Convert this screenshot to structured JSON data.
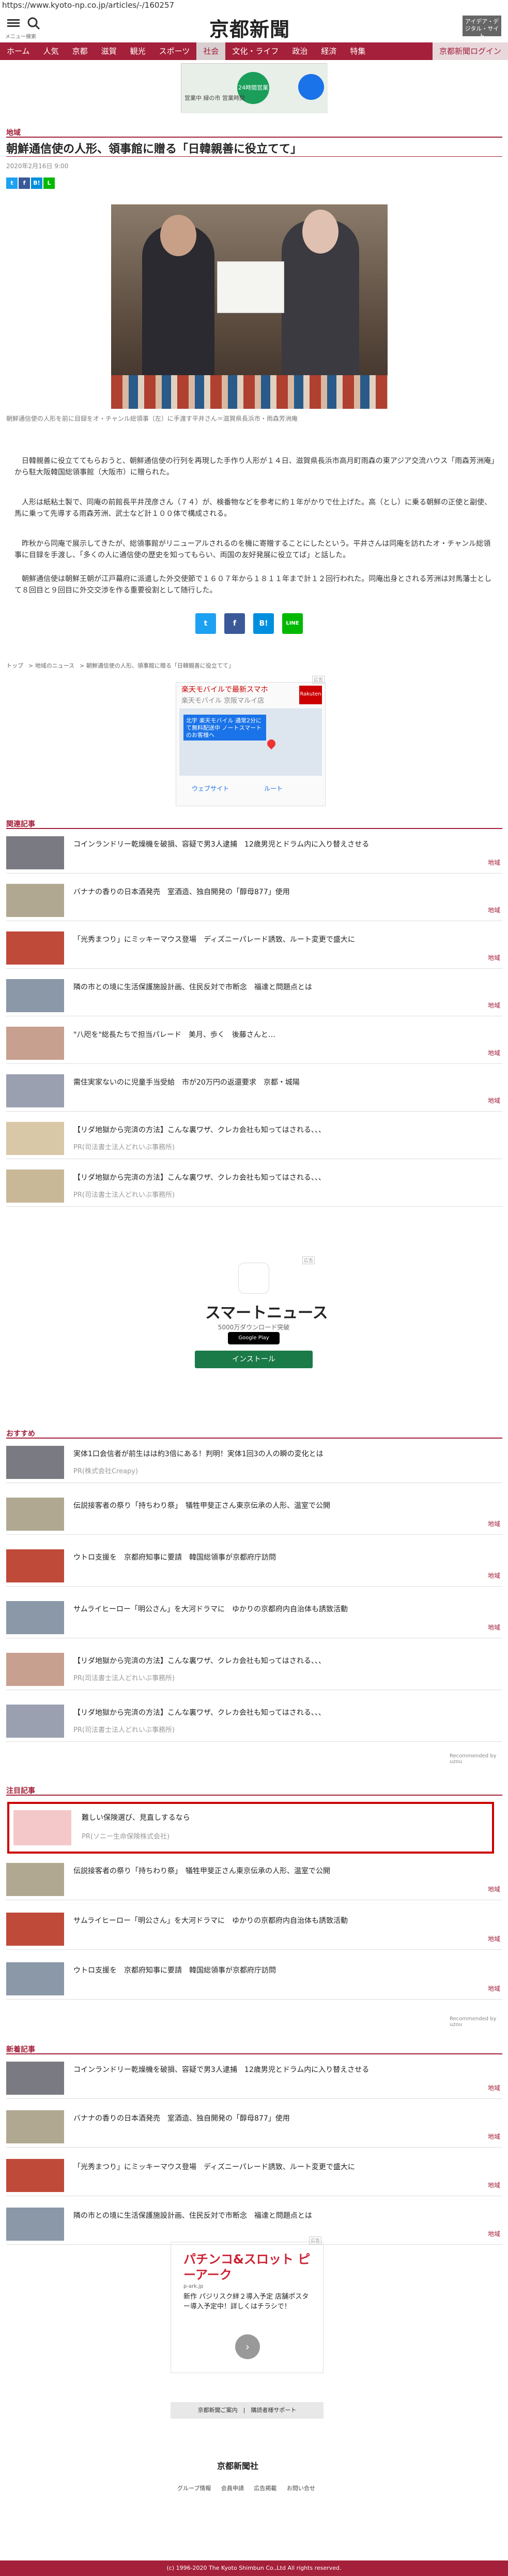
{
  "url": "https://www.kyoto-np.co.jp/articles/-/160257",
  "header": {
    "logo": "京都新聞",
    "menu_label": "メニュー",
    "search_label": "検索",
    "premium": "アイデア・デジタル・サイト"
  },
  "nav": {
    "items": [
      "ホーム",
      "人気",
      "京都",
      "滋賀",
      "観光",
      "スポーツ",
      "社会",
      "文化・ライフ",
      "政治",
      "経済",
      "特集"
    ],
    "active": "社会",
    "login": "京都新聞ログイン"
  },
  "top_ad": {
    "button": "24時間営業",
    "label": "営業中\n緑の市\n営業時間"
  },
  "article": {
    "section": "地域",
    "title": "朝鮮通信使の人形、領事館に贈る「日韓親善に役立てて」",
    "date": "2020年2月16日 9:00",
    "caption": "朝鮮通信使の人形を前に目録をオ・チャンル総領事（左）に手渡す平井さん＝滋賀県長浜市・雨森芳洲庵",
    "paragraphs": [
      "　日韓親善に役立ててもらおうと、朝鮮通信使の行列を再現した手作り人形が１４日、滋賀県長浜市高月町雨森の東アジア交流ハウス「雨森芳洲庵」から駐大阪韓国総領事館（大阪市）に贈られた。",
      "　人形は紙粘土製で、同庵の前館長平井茂彦さん（７４）が、検番物などを参考に約１年がかりで仕上げた。高（とし）に乗る朝鮮の正使と副使、馬に乗って先導する雨森芳洲、武士など計１００体で構成される。",
      "　昨秋から同庵で展示してきたが、総領事館がリニューアルされるのを機に寄贈することにしたという。平井さんは同庵を訪れたオ・チャンル総領事に目録を手渡し、「多くの人に通信使の歴史を知ってもらい、両国の友好発展に役立てば」と話した。",
      "　朝鮮通信使は朝鮮王朝が江戸幕府に派遣した外交使節で１６０７年から１８１１年まで計１２回行われた。同庵出身とされる芳洲は対馬藩士として８回目と９回目に外交交渉を作る重要役割として随行した。"
    ]
  },
  "share": {
    "icons": [
      "twitter-icon",
      "facebook-icon",
      "hatena-icon",
      "line-icon"
    ],
    "labels": [
      "t",
      "f",
      "B!",
      "L"
    ],
    "big_labels": [
      "t",
      "f",
      "B!",
      "LINE"
    ]
  },
  "breadcrumb": [
    "トップ",
    "地域のニュース",
    "朝鮮通信使の人形、領事館に贈る「日韓親善に役立てて」"
  ],
  "ad2": {
    "title": "楽天モバイルで最新スマホ",
    "sub": "楽天モバイル 京阪マルイ店",
    "rk": "Rakuten",
    "blue": "北宇 楽天モバイル\n通常2分にて無料配送中 ノートスマートのお客様へ",
    "bt1": "ウェブサイト",
    "bt2": "ルート",
    "tag": "広告"
  },
  "related": {
    "title": "関連記事",
    "items": [
      {
        "text": "コインランドリー乾燥機を破損、容疑で男3人逮捕　12歳男児とドラム内に入り替えさせる",
        "tag": "地域"
      },
      {
        "text": "バナナの香りの日本酒発売　室酒造、独自開発の「醇母877」使用",
        "tag": "地域"
      },
      {
        "text": "「光秀まつり」にミッキーマウス登場　ディズニーパレード誘致、ルート変更で盛大に",
        "tag": "地域"
      },
      {
        "text": "隣の市との境に生活保護施設計画、住民反対で市断念　福達と問題点とは",
        "tag": "地域"
      },
      {
        "text": "\"八咫を\"総長たちで担当パレード　美月、歩く　後藤さんと…",
        "tag": "地域"
      },
      {
        "text": "需住実家ないのに児童手当受給　市が20万円の返還要求　京都・城陽",
        "tag": "地域"
      },
      {
        "text": "【リダ地獄から完済の方法】こんな裏ワザ、クレカ会社も知ってはされる、、、",
        "pr": "PR(司法書士法人どれいぶ事務所)"
      },
      {
        "text": "【リダ地獄から完済の方法】こんな裏ワザ、クレカ会社も知ってはされる、、、",
        "pr": "PR(司法書士法人どれいぶ事務所)"
      }
    ]
  },
  "smartnews": {
    "tag": "広告",
    "name": "スマートニュース",
    "dl": "5000万ダウンロード突破",
    "gp": "Google Play",
    "install": "インストール"
  },
  "recommend": {
    "title": "おすすめ",
    "items": [
      {
        "text": "実体1口会信者が前生はは約3倍にある！判明！実体1回3の人の瞬の変化とは",
        "pr": "PR(株式会社Creapy)"
      },
      {
        "text": "伝説接客者の祭り「持ちわり祭」　犠牲甲斐正さん東京伝承の人形、温室で公開",
        "tag": "地域"
      },
      {
        "text": "ウトロ支援を　京都府知事に要請　韓国総領事が京都府庁訪問",
        "tag": "地域"
      },
      {
        "text": "サムライヒーロー「明公さん」を大河ドラマに　ゆかりの京都府内自治体も誘致活動",
        "tag": "地域"
      },
      {
        "text": "【リダ地獄から完済の方法】こんな裏ワザ、クレカ会社も知ってはされる、、、",
        "pr": "PR(司法書士法人どれいぶ事務所)"
      },
      {
        "text": "【リダ地獄から完済の方法】こんな裏ワザ、クレカ会社も知ってはされる、、、",
        "pr": "PR(司法書士法人どれいぶ事務所)"
      }
    ],
    "powered": "Recommended by uzou"
  },
  "featured": {
    "title": "注目記事",
    "items": [
      {
        "text": "難しい保険選び、見直しするなら",
        "pr": "PR(ソニー生命保険株式会社)"
      },
      {
        "text": "伝説接客者の祭り「持ちわり祭」　犠牲甲斐正さん東京伝承の人形、温室で公開",
        "tag": "地域"
      },
      {
        "text": "サムライヒーロー「明公さん」を大河ドラマに　ゆかりの京都府内自治体も誘致活動",
        "tag": "地域"
      },
      {
        "text": "ウトロ支援を　京都府知事に要請　韓国総領事が京都府庁訪問",
        "tag": "地域"
      }
    ],
    "powered": "Recommended by uzou"
  },
  "latest": {
    "title": "新着記事",
    "items": [
      {
        "text": "コインランドリー乾燥機を破損、容疑で男3人逮捕　12歳男児とドラム内に入り替えさせる",
        "tag": "地域"
      },
      {
        "text": "バナナの香りの日本酒発売　室酒造、独自開発の「醇母877」使用",
        "tag": "地域"
      },
      {
        "text": "「光秀まつり」にミッキーマウス登場　ディズニーパレード誘致、ルート変更で盛大に",
        "tag": "地域"
      },
      {
        "text": "隣の市との境に生活保護施設計画、住民反対で市断念　福達と問題点とは",
        "tag": "地域"
      }
    ]
  },
  "ad4": {
    "title": "パチンコ&スロット ピーアーク",
    "url": "p-ark.jp",
    "desc": "新作 パジリスク絆２導入予定 店舗ポスター導入予定中！詳しくはチラシで！",
    "tag": "広告",
    "next": "›"
  },
  "links": "京都新聞ご案内　|　購読者様サポート",
  "footer": {
    "logo": "京都新聞社",
    "links": [
      "グループ情報",
      "会員申請",
      "広告掲載",
      "お問い合せ"
    ],
    "copy": "(c) 1996-2020 The Kyoto Shimbun Co.,Ltd All rights reserved."
  }
}
